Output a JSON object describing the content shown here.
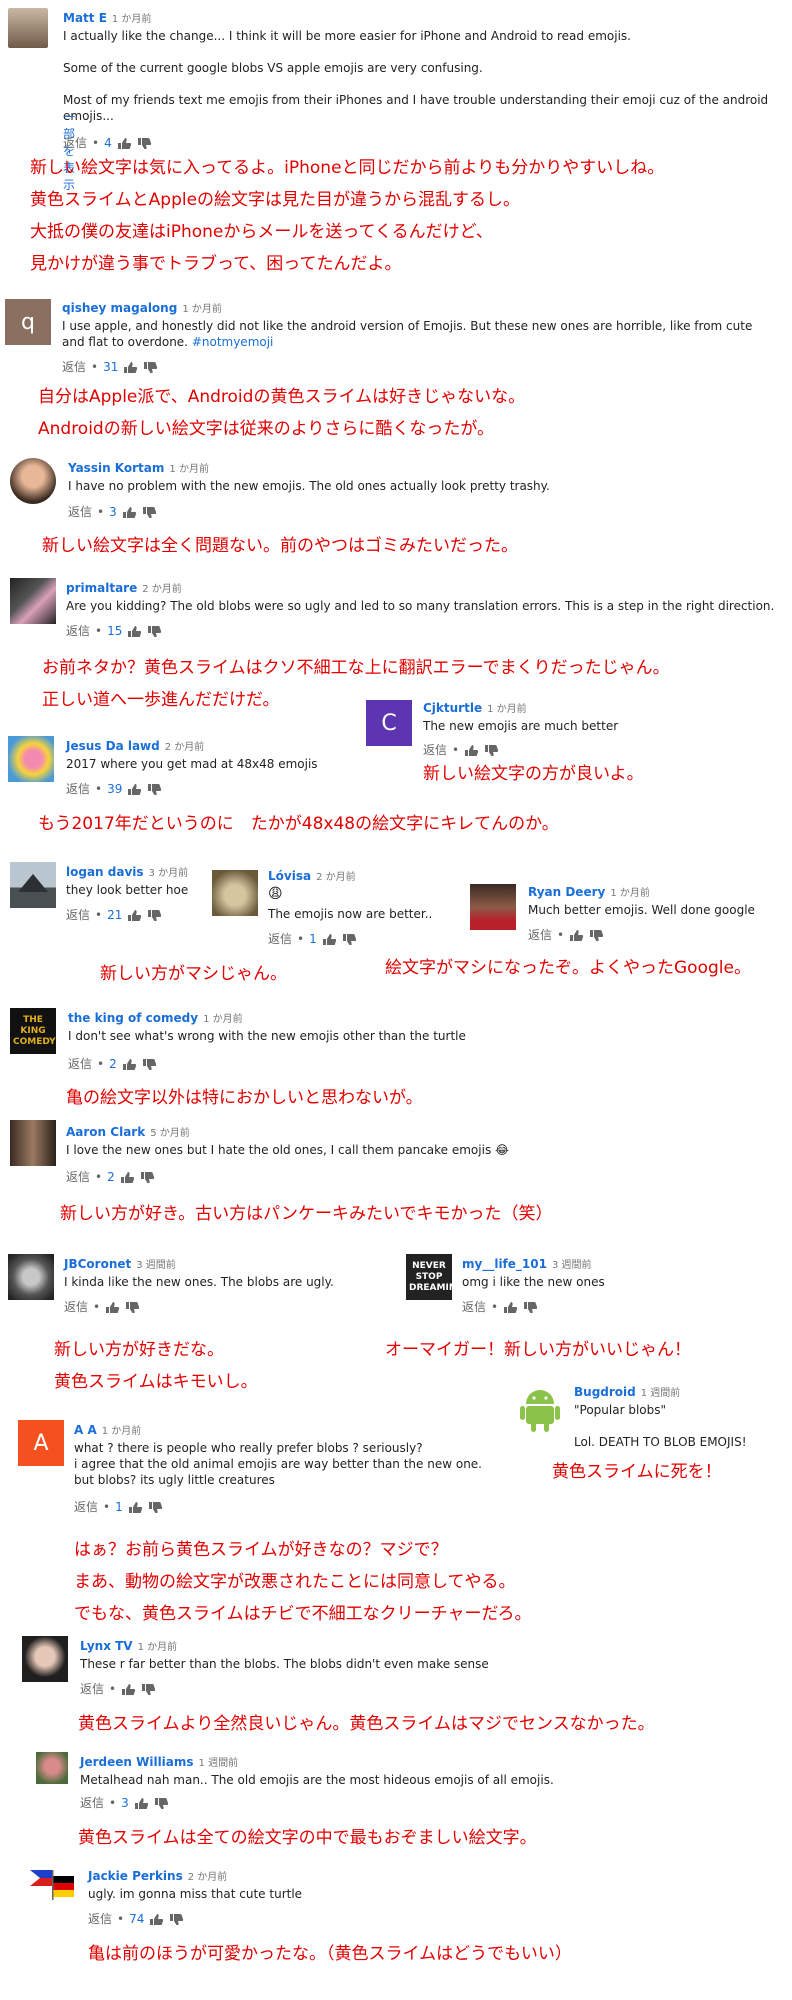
{
  "ui": {
    "reply": "返信"
  },
  "c1": {
    "name": "Matt E",
    "time": "1 か月前",
    "text": "I actually like the change... I think it will be more easier for iPhone and Android to read emojis.\n\nSome of the current google blobs VS apple emojis are very confusing.\n\nMost of my friends text me emojis from their iPhones and I have trouble understanding their emoji cuz of the android emojis...",
    "more": "一部を表示",
    "count": "4",
    "tr": "新しい絵文字は気に入ってるよ。iPhoneと同じだから前よりも分かりやすいしね。\n黄色スライムとAppleの絵文字は見た目が違うから混乱するし。\n大抵の僕の友達はiPhoneからメールを送ってくるんだけど、\n見かけが違う事でトラブって、困ってたんだよ。"
  },
  "c2": {
    "name": "qishey magalong",
    "time": "1 か月前",
    "letter": "q",
    "text": "I use apple, and honestly did not like the android version of Emojis. But these new ones are horrible, like from cute and flat to overdone. ",
    "tag": "#notmyemoji",
    "count": "31",
    "tr": "自分はApple派で、Androidの黄色スライムは好きじゃないな。\nAndroidの新しい絵文字は従来のよりさらに酷くなったが。"
  },
  "c3": {
    "name": "Yassin Kortam",
    "time": "1 か月前",
    "text": "I have no problem with the new emojis. The old ones actually look pretty trashy.",
    "count": "3",
    "tr": "新しい絵文字は全く問題ない。前のやつはゴミみたいだった。"
  },
  "c4": {
    "name": "primaltare",
    "time": "2 か月前",
    "text": "Are you kidding? The old blobs were so ugly and led to so many translation errors. This is a step in the right direction.",
    "count": "15",
    "tr": "お前ネタか？黄色スライムはクソ不細工な上に翻訳エラーでまくりだったじゃん。\n正しい道へ一歩進んだだけだ。"
  },
  "c5": {
    "name": "Cjkturtle",
    "time": "1 か月前",
    "letter": "C",
    "text": "The new emojis are much better",
    "tr": "新しい絵文字の方が良いよ。"
  },
  "c6": {
    "name": "Jesus Da lawd",
    "time": "2 か月前",
    "text": "2017 where you get mad at 48x48 emojis",
    "count": "39",
    "tr": "もう2017年だというのに　たかが48x48の絵文字にキレてんのか。"
  },
  "c7": {
    "name": "logan davis",
    "time": "3 か月前",
    "text": "they look better hoe",
    "count": "21",
    "tr": "新しい方がマシじゃん。"
  },
  "c8": {
    "name": "Lóvisa",
    "time": "2 か月前",
    "emoji": "😩",
    "text": "The emojis now are better..",
    "count": "1"
  },
  "c9": {
    "name": "Ryan Deery",
    "time": "1 か月前",
    "text": "Much better emojis. Well done google",
    "tr": "絵文字がマシになったぞ。よくやったGoogle。"
  },
  "c10": {
    "name": "the king of comedy",
    "time": "1 か月前",
    "avatar_text": "THE KING COMEDY",
    "text": "I don't see what's wrong with the new emojis other than the turtle",
    "count": "2",
    "tr": "亀の絵文字以外は特におかしいと思わないが。"
  },
  "c11": {
    "name": "Aaron Clark",
    "time": "5 か月前",
    "text": "I love the new ones but I hate the old ones, I call them pancake emojis",
    "emoji": "😂",
    "count": "2",
    "tr": "新しい方が好き。古い方はパンケーキみたいでキモかった（笑）"
  },
  "c12": {
    "name": "JBCoronet",
    "time": "3 週間前",
    "text": "I kinda like the new ones. The blobs are ugly.",
    "tr": "新しい方が好きだな。\n黄色スライムはキモいし。"
  },
  "c13": {
    "name": "my__life_101",
    "time": "3 週間前",
    "avatar_text": "NEVER STOP DREAMING",
    "text": "omg i like the new ones",
    "tr": "オーマイガー！新しい方がいいじゃん！"
  },
  "c14": {
    "name": "Bugdroid",
    "time": "1 週間前",
    "text": "\"Popular blobs\"\n\nLol. DEATH TO BLOB EMOJIS!",
    "tr": "黄色スライムに死を！"
  },
  "c15": {
    "name": "A A",
    "time": "1 か月前",
    "letter": "A",
    "text": "what ? there is people who really prefer blobs ? seriously?\ni agree that the old animal emojis are way better than the new one.\nbut blobs? its ugly little creatures",
    "count": "1",
    "tr": "はぁ？お前ら黄色スライムが好きなの？マジで？\nまあ、動物の絵文字が改悪されたことには同意してやる。\nでもな、黄色スライムはチビで不細工なクリーチャーだろ。"
  },
  "c16": {
    "name": "Lynx TV",
    "time": "1 か月前",
    "text": "These r far better than the blobs. The blobs didn't even make sense",
    "tr": "黄色スライムより全然良いじゃん。黄色スライムはマジでセンスなかった。"
  },
  "c17": {
    "name": "Jerdeen Williams",
    "time": "1 週間前",
    "text": "Metalhead nah man.. The old emojis are the most hideous emojis of all emojis.",
    "count": "3",
    "tr": "黄色スライムは全ての絵文字の中で最もおぞましい絵文字。"
  },
  "c18": {
    "name": "Jackie Perkins",
    "time": "2 か月前",
    "text": "ugly. im gonna miss that cute turtle",
    "count": "74",
    "tr": "亀は前のほうが可愛かったな。（黄色スライムはどうでもいい）"
  }
}
